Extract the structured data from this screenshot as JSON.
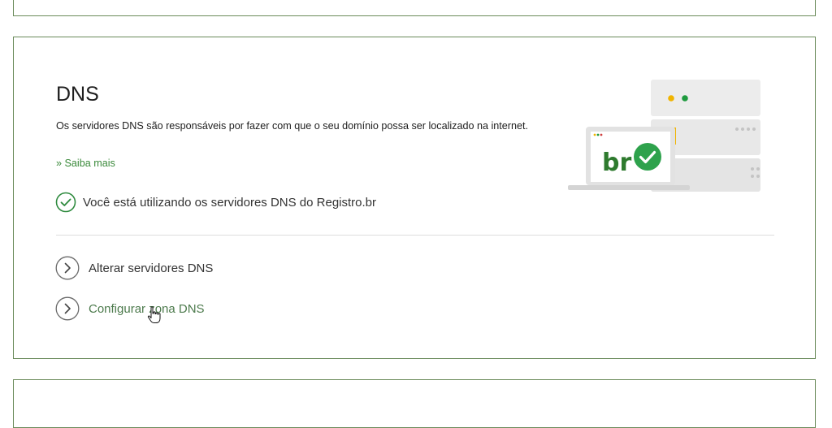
{
  "dns_card": {
    "title": "DNS",
    "description": "Os servidores DNS são responsáveis por fazer com que o seu domínio possa ser localizado na internet.",
    "learn_more": "» Saiba mais",
    "status_text": "Você está utilizando os servidores DNS do Registro.br",
    "actions": [
      {
        "label": "Alterar servidores DNS",
        "icon": "chevron-right-circle-icon"
      },
      {
        "label": "Configurar zona DNS",
        "icon": "chevron-right-circle-icon"
      }
    ],
    "illustration": {
      "laptop_text": "br",
      "icons": [
        "server-rack-icon",
        "laptop-icon",
        "check-circle-icon"
      ]
    }
  },
  "colors": {
    "accent_green": "#2e9a4a",
    "border": "#6a8a5a",
    "link_green": "#3b8a3b"
  }
}
